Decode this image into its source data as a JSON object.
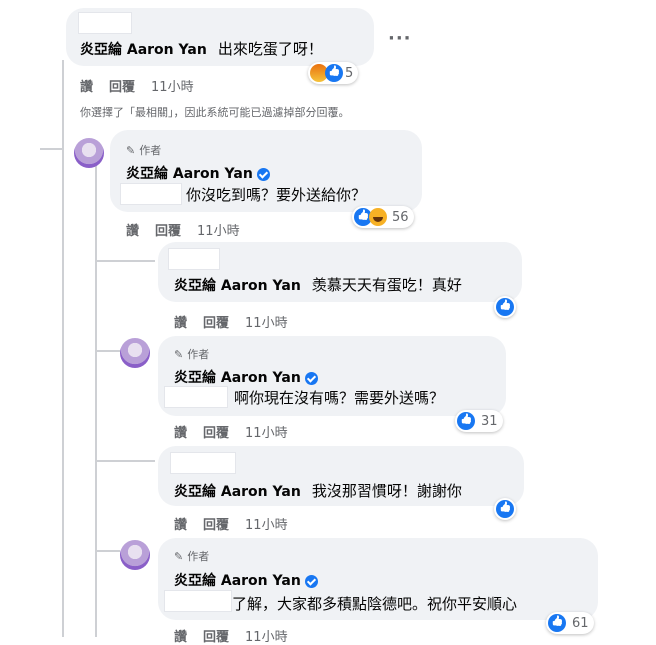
{
  "colors": {
    "bubble": "#f0f2f5",
    "meta": "#65676b",
    "like": "#1877f2"
  },
  "top_comment": {
    "name": "炎亞綸 Aaron Yan",
    "text": "出來吃蛋了呀！",
    "more": "···",
    "reaction_count": "5",
    "reactions": [
      "angry-icon",
      "like-icon"
    ],
    "like": "讚",
    "reply": "回覆",
    "time": "11小時"
  },
  "notice": "你選擇了「最相關」，因此系統可能已過濾掉部分回覆。",
  "replies": [
    {
      "author_badge": "作者",
      "name": "炎亞綸 Aaron Yan",
      "text": "你沒吃到嗎？要外送給你？",
      "reaction_count": "56",
      "like": "讚",
      "reply": "回覆",
      "time": "11小時"
    },
    {
      "name": "炎亞綸 Aaron Yan",
      "text": "羡慕天天有蛋吃！真好",
      "like": "讚",
      "reply": "回覆",
      "time": "11小時"
    },
    {
      "author_badge": "作者",
      "name": "炎亞綸 Aaron Yan",
      "text": "啊你現在沒有嗎？需要外送嗎？",
      "reaction_count": "31",
      "like": "讚",
      "reply": "回覆",
      "time": "11小時"
    },
    {
      "name": "炎亞綸 Aaron Yan",
      "text": "我沒那習慣呀！謝謝你",
      "like": "讚",
      "reply": "回覆",
      "time": "11小時"
    },
    {
      "author_badge": "作者",
      "name": "炎亞綸 Aaron Yan",
      "text": "了解，大家都多積點陰德吧。祝你平安順心",
      "reaction_count": "61",
      "like": "讚",
      "reply": "回覆",
      "time": "11小時"
    }
  ]
}
